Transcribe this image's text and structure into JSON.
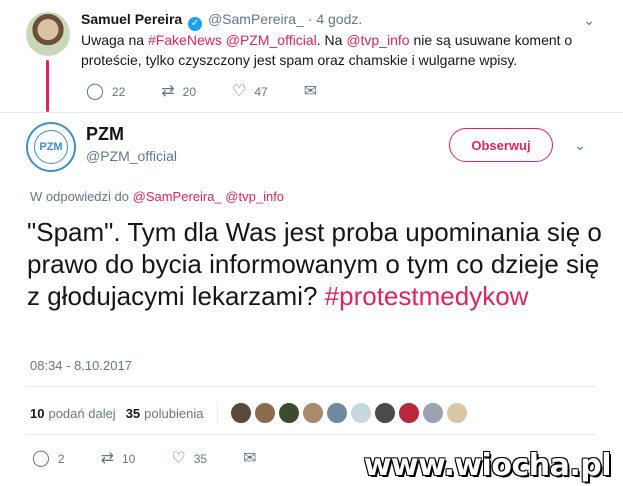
{
  "parent_tweet": {
    "name": "Samuel Pereira",
    "handle": "@SamPereira_",
    "time": "4 godz.",
    "text_pre": "Uwaga na ",
    "hashtag": "#FakeNews",
    "mention1": "@PZM_official",
    "text_mid": ". Na ",
    "mention2": "@tvp_info",
    "text_post": " nie są usuwane koment o proteście, tylko czyszczony jest spam oraz chamskie i wulgarne wpisy.",
    "reply_count": "22",
    "retweet_count": "20",
    "like_count": "47"
  },
  "main_tweet": {
    "name": "PZM",
    "handle": "@PZM_official",
    "avatar_text": "PZM",
    "follow_label": "Obserwuj",
    "reply_prefix": "W odpowiedzi do ",
    "reply_mentions": "@SamPereira_ @tvp_info",
    "text": "\"Spam\". Tym dla Was jest proba upominania się o prawo do bycia informowanym o tym co dzieje się z głodujacymi lekarzami? ",
    "hashtag": "#protestmedykow",
    "timestamp": "08:34 - 8.10.2017",
    "retweets_num": "10",
    "retweets_label": "podań dalej",
    "likes_num": "35",
    "likes_label": "polubienia",
    "reply_count": "2",
    "retweet_count": "10",
    "like_count": "35"
  },
  "liker_colors": [
    "#5a4a3a",
    "#8c6b4f",
    "#3d4a2e",
    "#a88b6a",
    "#6f8a9c",
    "#c8d6e0",
    "#4a4a4a",
    "#b8283a",
    "#9aa4b0",
    "#d9c7a8"
  ],
  "watermark": "www.wiocha.pl",
  "colors": {
    "accent": "#e0245e",
    "muted": "#657786",
    "verified": "#1da1f2"
  }
}
